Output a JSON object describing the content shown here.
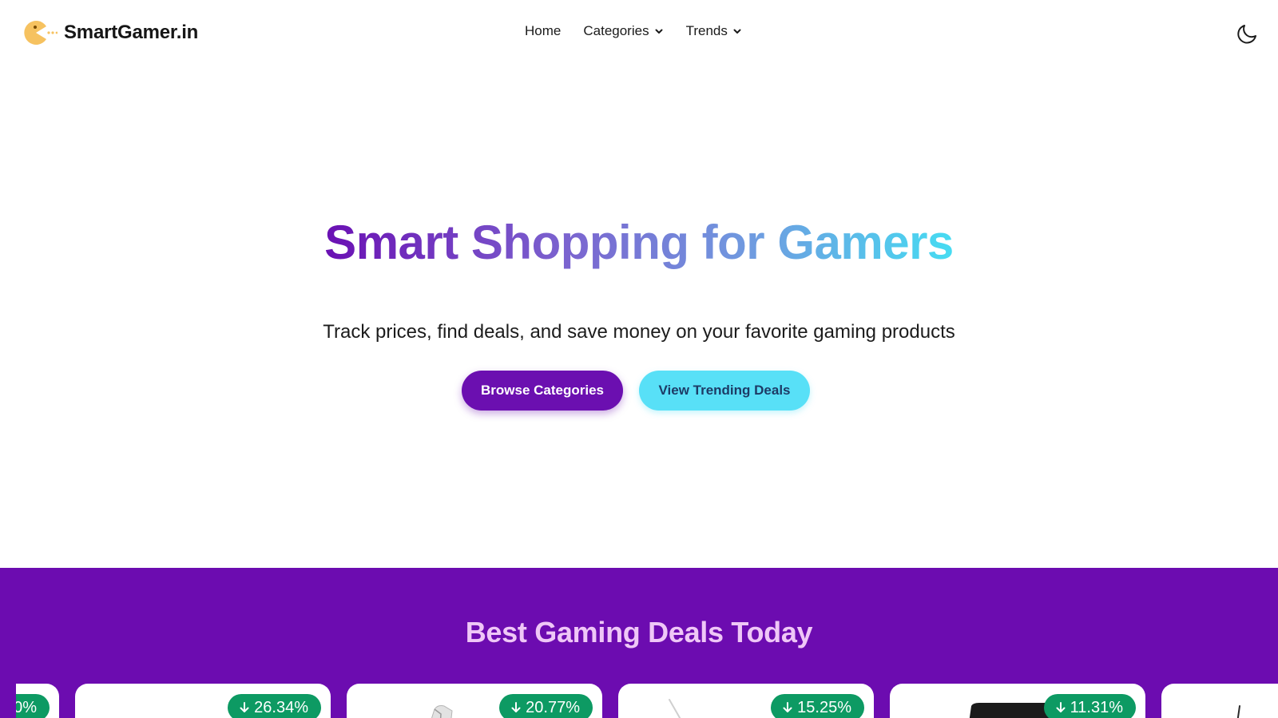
{
  "header": {
    "logo_text": "SmartGamer.in",
    "nav": [
      {
        "label": "Home",
        "has_dropdown": false
      },
      {
        "label": "Categories",
        "has_dropdown": true
      },
      {
        "label": "Trends",
        "has_dropdown": true
      }
    ],
    "theme_toggle_icon": "moon-icon"
  },
  "hero": {
    "title": "Smart Shopping for Gamers",
    "subtitle": "Track prices, find deals, and save money on your favorite gaming products",
    "primary_button": "Browse Categories",
    "secondary_button": "View Trending Deals"
  },
  "deals": {
    "title": "Best Gaming Deals Today",
    "cards": [
      {
        "discount": "0%"
      },
      {
        "discount": "26.34%"
      },
      {
        "discount": "20.77%"
      },
      {
        "discount": "15.25%"
      },
      {
        "discount": "11.31%"
      },
      {
        "discount": ""
      }
    ]
  },
  "colors": {
    "brand_purple": "#6c0cb0",
    "accent_cyan": "#58e0f7",
    "discount_green": "#0d9a63",
    "deals_title": "#efc7f7"
  }
}
